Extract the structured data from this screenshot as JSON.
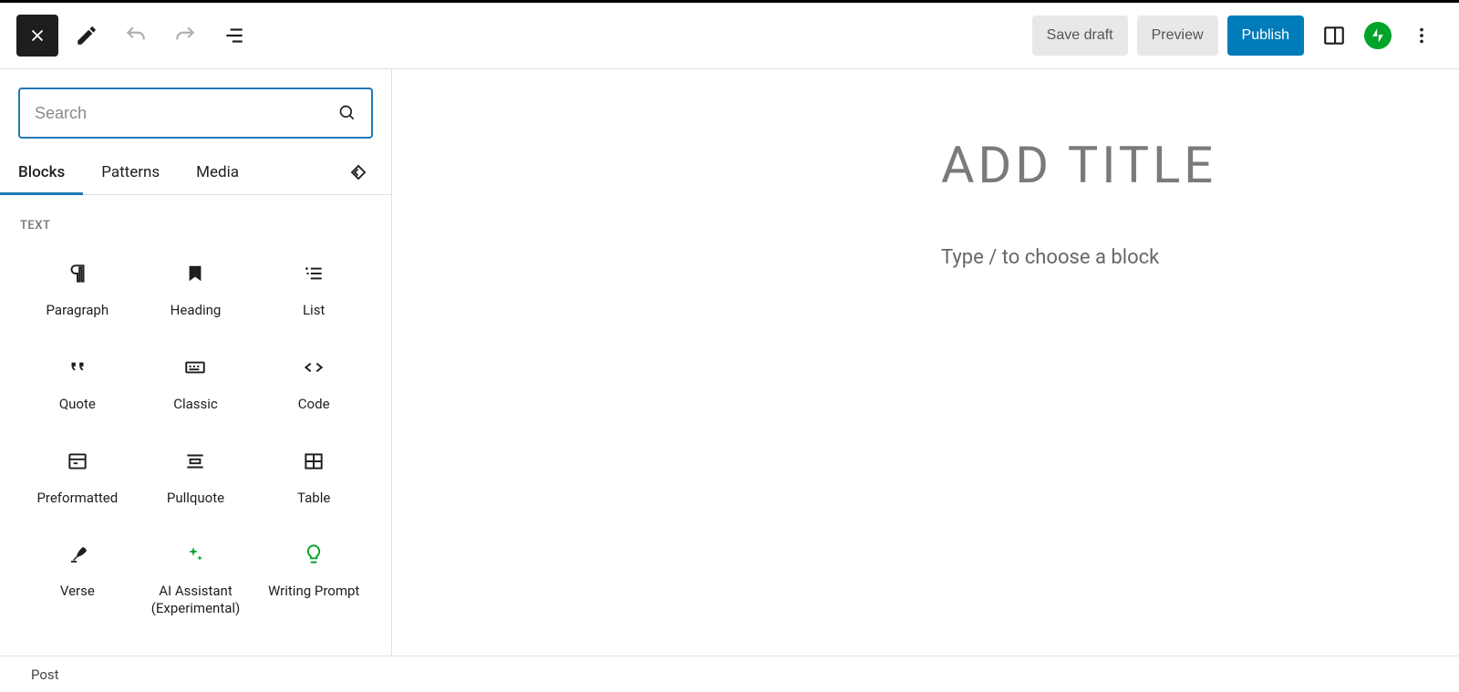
{
  "toolbar": {
    "save_draft": "Save draft",
    "preview": "Preview",
    "publish": "Publish"
  },
  "inserter": {
    "search_placeholder": "Search",
    "tabs": {
      "blocks": "Blocks",
      "patterns": "Patterns",
      "media": "Media"
    },
    "section_label": "TEXT",
    "blocks": [
      {
        "label": "Paragraph",
        "icon": "paragraph"
      },
      {
        "label": "Heading",
        "icon": "heading"
      },
      {
        "label": "List",
        "icon": "list"
      },
      {
        "label": "Quote",
        "icon": "quote"
      },
      {
        "label": "Classic",
        "icon": "classic"
      },
      {
        "label": "Code",
        "icon": "code"
      },
      {
        "label": "Preformatted",
        "icon": "preformatted"
      },
      {
        "label": "Pullquote",
        "icon": "pullquote"
      },
      {
        "label": "Table",
        "icon": "table"
      },
      {
        "label": "Verse",
        "icon": "verse"
      },
      {
        "label": "AI Assistant (Experimental)",
        "icon": "ai",
        "green": true
      },
      {
        "label": "Writing Prompt",
        "icon": "prompt",
        "green": true
      }
    ]
  },
  "editor": {
    "title_placeholder": "ADD TITLE",
    "paragraph_placeholder": "Type / to choose a block"
  },
  "footer": {
    "crumb": "Post"
  }
}
